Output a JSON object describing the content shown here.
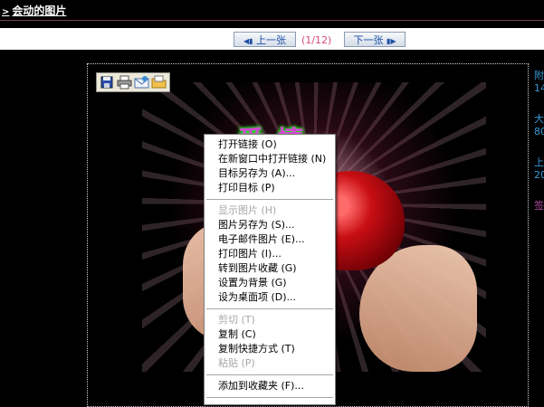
{
  "header": {
    "arrow": ">",
    "title": "会动的图片"
  },
  "nav": {
    "prev_label": "上一张",
    "next_label": "下一张",
    "page_indicator": "(1/12)"
  },
  "image": {
    "decorative_text": "爱情"
  },
  "info_column": [
    {
      "text": "附",
      "color": "blue"
    },
    {
      "text": "14",
      "color": "blue"
    },
    {
      "text": "",
      "color": "blue"
    },
    {
      "text": "大",
      "color": "blue"
    },
    {
      "text": "80",
      "color": "blue"
    },
    {
      "text": "",
      "color": "blue"
    },
    {
      "text": "上",
      "color": "blue"
    },
    {
      "text": "20",
      "color": "blue"
    },
    {
      "text": "",
      "color": "blue"
    },
    {
      "text": "签",
      "color": "pink"
    }
  ],
  "context_menu": {
    "groups": [
      [
        {
          "label": "打开链接 (O)",
          "enabled": true
        },
        {
          "label": "在新窗口中打开链接 (N)",
          "enabled": true
        },
        {
          "label": "目标另存为 (A)...",
          "enabled": true
        },
        {
          "label": "打印目标 (P)",
          "enabled": true
        }
      ],
      [
        {
          "label": "显示图片 (H)",
          "enabled": false
        },
        {
          "label": "图片另存为 (S)...",
          "enabled": true
        },
        {
          "label": "电子邮件图片 (E)...",
          "enabled": true
        },
        {
          "label": "打印图片 (I)...",
          "enabled": true
        },
        {
          "label": "转到图片收藏 (G)",
          "enabled": true
        },
        {
          "label": "设置为背景 (G)",
          "enabled": true
        },
        {
          "label": "设为桌面项 (D)...",
          "enabled": true
        }
      ],
      [
        {
          "label": "剪切 (T)",
          "enabled": false
        },
        {
          "label": "复制 (C)",
          "enabled": true
        },
        {
          "label": "复制快捷方式 (T)",
          "enabled": true
        },
        {
          "label": "粘贴 (P)",
          "enabled": false
        }
      ],
      [
        {
          "label": "添加到收藏夹 (F)...",
          "enabled": true
        }
      ]
    ]
  },
  "toolbar_icons": [
    "save-icon",
    "print-icon",
    "email-icon",
    "folder-icon"
  ],
  "colors": {
    "accent_pink": "#d9487e",
    "link_blue": "#1d4fa5",
    "info_blue": "#3a9ad9"
  }
}
